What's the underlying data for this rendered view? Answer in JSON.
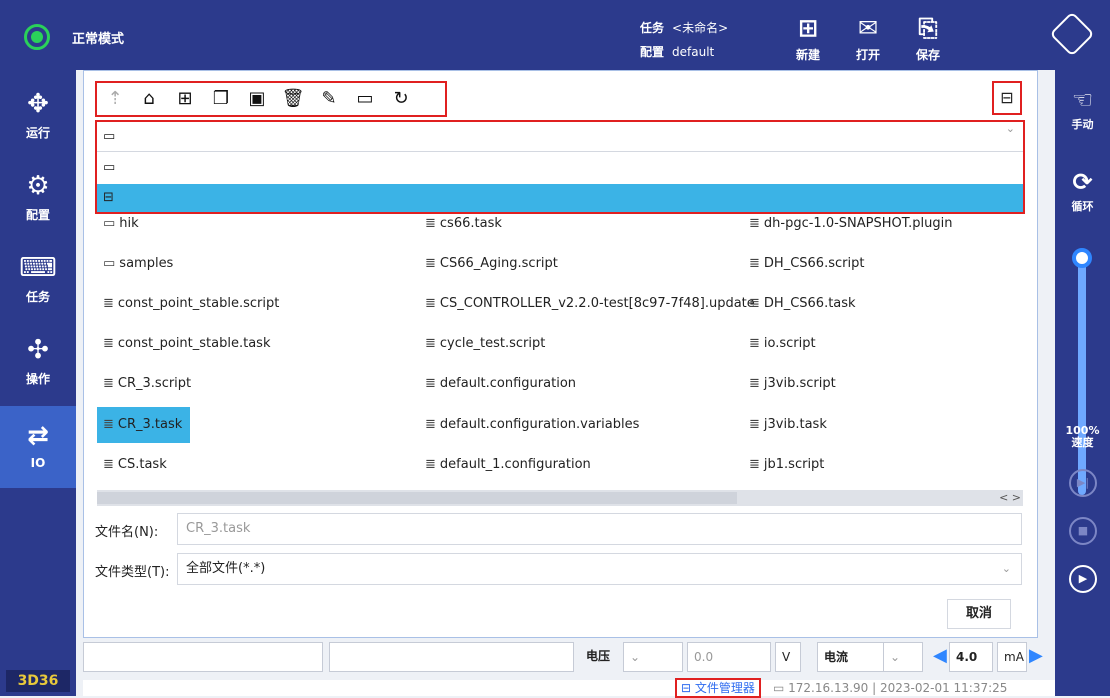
{
  "header": {
    "mode": "正常模式",
    "task_label": "任务",
    "task_value": "<未命名>",
    "config_label": "配置",
    "config_value": "default",
    "new_label": "新建",
    "open_label": "打开",
    "save_label": "保存"
  },
  "sidebar": {
    "items": [
      {
        "label": "运行",
        "icon": "run-icon"
      },
      {
        "label": "配置",
        "icon": "gear-icon"
      },
      {
        "label": "任务",
        "icon": "code-icon"
      },
      {
        "label": "操作",
        "icon": "move-icon"
      },
      {
        "label": "IO",
        "icon": "io-icon"
      }
    ],
    "version": "3D36"
  },
  "rightbar": {
    "manual_label": "手动",
    "loop_label": "循环",
    "speed_percent": "100%",
    "speed_label": "速度",
    "speed_fraction": 1.0
  },
  "dialog": {
    "combo_selected": "computer-icon",
    "combo_options": [
      "computer-icon",
      "usb-icon"
    ],
    "files": [
      {
        "name": "hik",
        "type": "folder"
      },
      {
        "name": "cs66.task",
        "type": "file"
      },
      {
        "name": "dh-pgc-1.0-SNAPSHOT.plugin",
        "type": "file"
      },
      {
        "name": "samples",
        "type": "folder"
      },
      {
        "name": "CS66_Aging.script",
        "type": "file"
      },
      {
        "name": "DH_CS66.script",
        "type": "file"
      },
      {
        "name": "const_point_stable.script",
        "type": "file"
      },
      {
        "name": "CS_CONTROLLER_v2.2.0-test[8c97-7f48].update",
        "type": "file"
      },
      {
        "name": "DH_CS66.task",
        "type": "file"
      },
      {
        "name": "const_point_stable.task",
        "type": "file"
      },
      {
        "name": "cycle_test.script",
        "type": "file"
      },
      {
        "name": "io.script",
        "type": "file"
      },
      {
        "name": "CR_3.script",
        "type": "file"
      },
      {
        "name": "default.configuration",
        "type": "file"
      },
      {
        "name": "j3vib.script",
        "type": "file"
      },
      {
        "name": "CR_3.task",
        "type": "file",
        "selected": true
      },
      {
        "name": "default.configuration.variables",
        "type": "file"
      },
      {
        "name": "j3vib.task",
        "type": "file"
      },
      {
        "name": "CS.task",
        "type": "file"
      },
      {
        "name": "default_1.configuration",
        "type": "file"
      },
      {
        "name": "jb1.script",
        "type": "file"
      }
    ],
    "filename_label": "文件名(N):",
    "filename_value": "CR_3.task",
    "filetype_label": "文件类型(T):",
    "filetype_value": "全部文件(*.*)",
    "cancel_label": "取消"
  },
  "bottom": {
    "voltage_label": "电压",
    "voltage_value": "0.0",
    "voltage_unit": "V",
    "current_label": "电流",
    "current_value": "4.0",
    "current_unit": "mA"
  },
  "statusbar": {
    "file_manager": "文件管理器",
    "ip": "172.16.13.90",
    "datetime": "2023-02-01 11:37:25"
  }
}
